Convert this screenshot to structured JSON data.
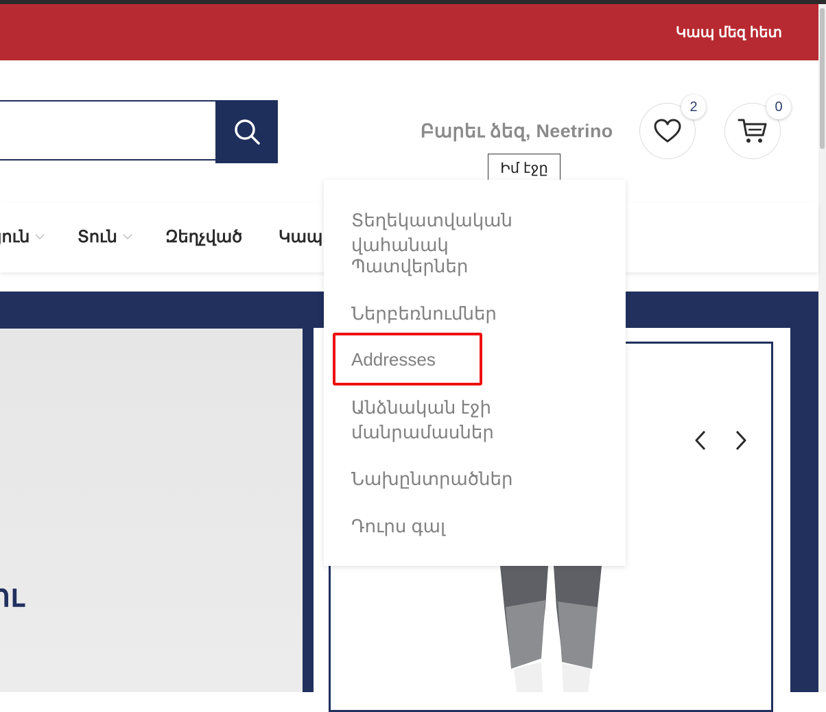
{
  "topbar": {
    "contact_label": "Կապ մեզ հետ",
    "background": "#b82a31"
  },
  "header": {
    "greeting": "Բարեւ ձեզ, Neetrino",
    "wishlist_count": "2",
    "cart_count": "0",
    "tooltip": "Իմ էջը"
  },
  "nav": {
    "items": [
      {
        "label": "յուն"
      },
      {
        "label": "Տուն"
      },
      {
        "label": "Զեղչված"
      },
      {
        "label": "Կապ"
      }
    ]
  },
  "account_menu": {
    "items": [
      {
        "label": "Տեղեկատվական վահանակ"
      },
      {
        "label": "Պատվերներ"
      },
      {
        "label": "Ներբեռնումներ"
      },
      {
        "label": "Addresses"
      },
      {
        "label": "Անձնական էջի մանրամասներ"
      },
      {
        "label": "Նախընտրածներ"
      },
      {
        "label": "Դուրս գալ"
      }
    ],
    "highlighted_item": "Addresses"
  },
  "hero": {
    "text_fragment": "ու"
  },
  "colors": {
    "brand_red": "#b82a31",
    "navy": "#21305d",
    "highlight": "#ee1111"
  },
  "icons": [
    "search-icon",
    "heart-icon",
    "cart-icon",
    "chevron-down-icon",
    "arrow-left-icon",
    "arrow-right-icon"
  ]
}
